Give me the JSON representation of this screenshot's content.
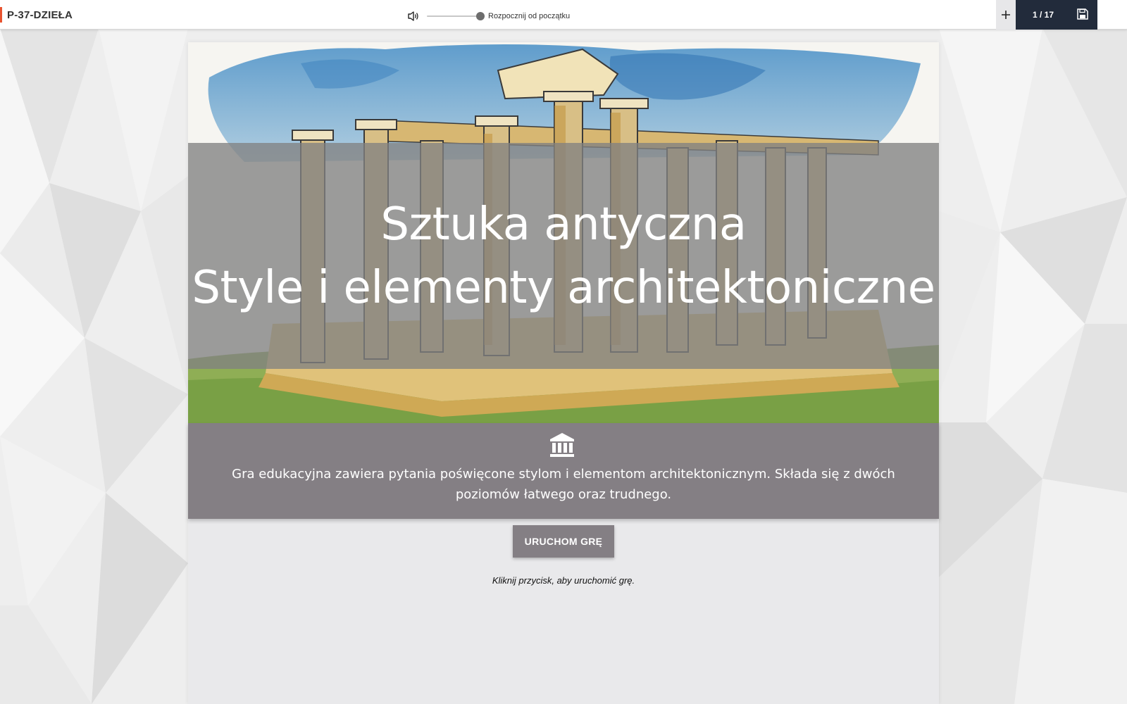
{
  "app": {
    "title": "P-37-DZIEŁA",
    "accent_color": "#e8532f"
  },
  "audio": {
    "speaker_icon": "speaker-icon",
    "volume_percent": 100,
    "restart_label": "Rozpocznij od początku"
  },
  "pager": {
    "add_icon": "plus-icon",
    "counter": "1 / 17",
    "save_icon": "floppy-disk-icon",
    "background_color": "#222b3b"
  },
  "slide": {
    "title_line1": "Sztuka antyczna",
    "title_line2": "Style i elementy architektoniczne",
    "hero_image": "watercolor-greek-temple",
    "info_icon": "museum-icon",
    "description": "Gra edukacyjna zawiera pytania poświęcone stylom i elementom architektonicznym. Składa się z dwóch poziomów łatwego oraz trudnego.",
    "start_button_label": "URUCHOM GRĘ",
    "hint": "Kliknij przycisk, aby uruchomić grę.",
    "band_color": "#847f84"
  }
}
